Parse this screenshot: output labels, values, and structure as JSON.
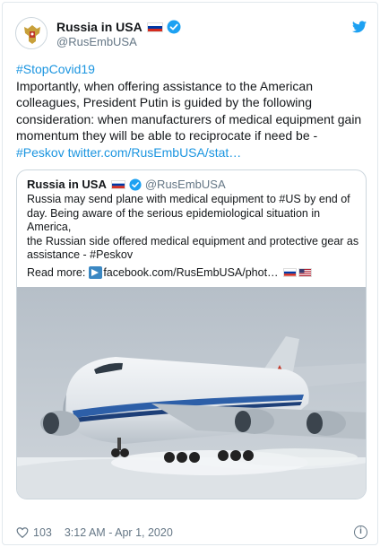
{
  "tweet": {
    "author_name": "Russia in USA",
    "author_handle": "@RusEmbUSA",
    "avatar_icon": "coat-of-arms-icon",
    "bird_icon": "twitter-bird-icon",
    "hashtag": "#StopCovid19",
    "text_line1": "Importantly, when offering assistance to the American",
    "text_line2": "colleagues, President Putin is guided by the following",
    "text_line3": "consideration: when manufacturers of medical equipment gain",
    "text_line4": "momentum they will be able to reciprocate if need be -",
    "text_tag": "#Peskov",
    "text_link": "twitter.com/RusEmbUSA/stat…"
  },
  "quoted": {
    "author_name": "Russia in USA",
    "author_handle": "@RusEmbUSA",
    "line1": "Russia may send plane with medical equipment to #US by end of",
    "line2": "day. Being aware of the serious epidemiological situation in America,",
    "line3": "the Russian side offered medical equipment and protective gear as",
    "line4": "assistance - #Peskov",
    "readmore_label": "Read more:",
    "readmore_link": "facebook.com/RusEmbUSA/phot…"
  },
  "footer": {
    "likes": "103",
    "timestamp": "3:12 AM - Apr 1, 2020"
  },
  "colors": {
    "link": "#1b95e0",
    "verified": "#1da1f2",
    "muted": "#657786"
  }
}
